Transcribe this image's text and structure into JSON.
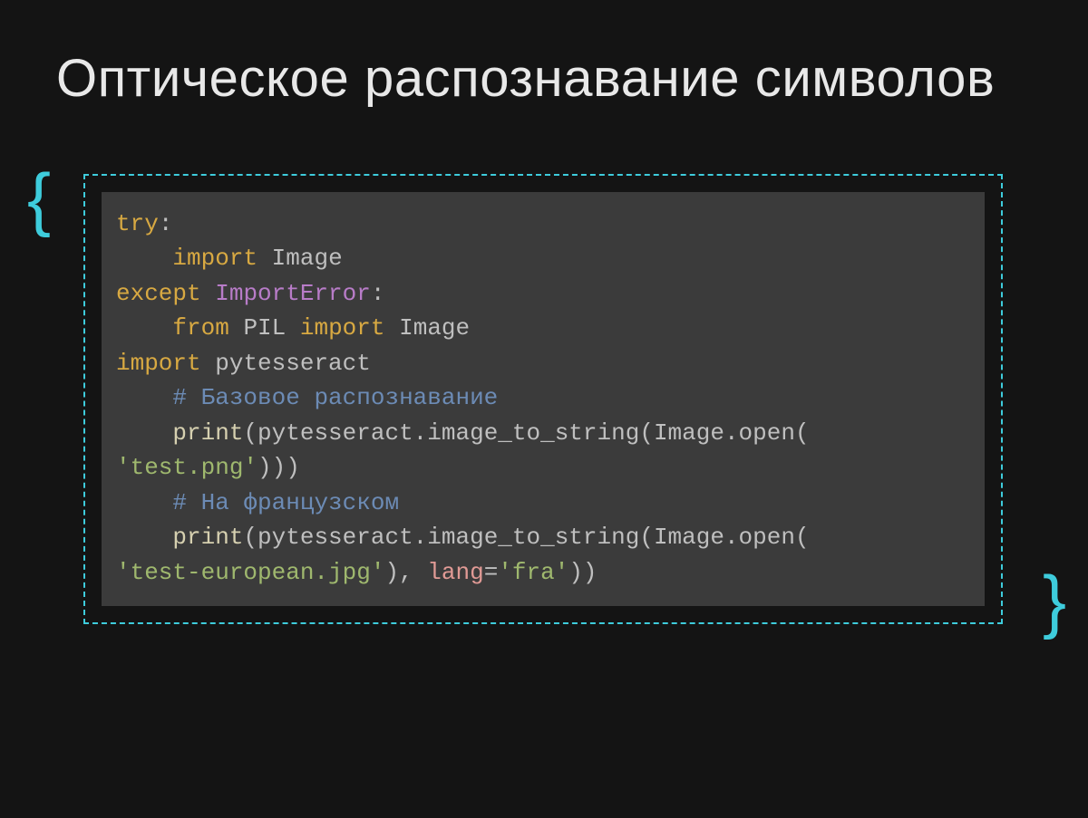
{
  "title": "Оптическое распознавание символов",
  "brace_left": "{",
  "brace_right": "}",
  "code": {
    "line1_try": "try",
    "line1_colon": ":",
    "line2_import": "import",
    "line2_image": "Image",
    "line3_except": "except",
    "line3_error": "ImportError",
    "line3_colon": ":",
    "line4_from": "from",
    "line4_pil": "PIL",
    "line4_import": "import",
    "line4_image": "Image",
    "line5_import": "import",
    "line5_pytesseract": "pytesseract",
    "line6_comment": "# Базовое распознавание",
    "line7_print": "print",
    "line7_open1": "(",
    "line7_pytesseract": "pytesseract.image_to_string",
    "line7_open2": "(",
    "line7_image": "Image.open",
    "line7_open3": "(",
    "line8_str": "'test.png'",
    "line8_close": ")))",
    "line9_comment": "# На французском",
    "line10_print": "print",
    "line10_open1": "(",
    "line10_pytesseract": "pytesseract.image_to_string",
    "line10_open2": "(",
    "line10_image": "Image.open",
    "line10_open3": "(",
    "line11_str": "'test-european.jpg'",
    "line11_close1": "), ",
    "line11_lang": "lang",
    "line11_eq": "=",
    "line11_str2": "'fra'",
    "line11_close2": "))",
    "indent1": "    ",
    "indent0": ""
  }
}
